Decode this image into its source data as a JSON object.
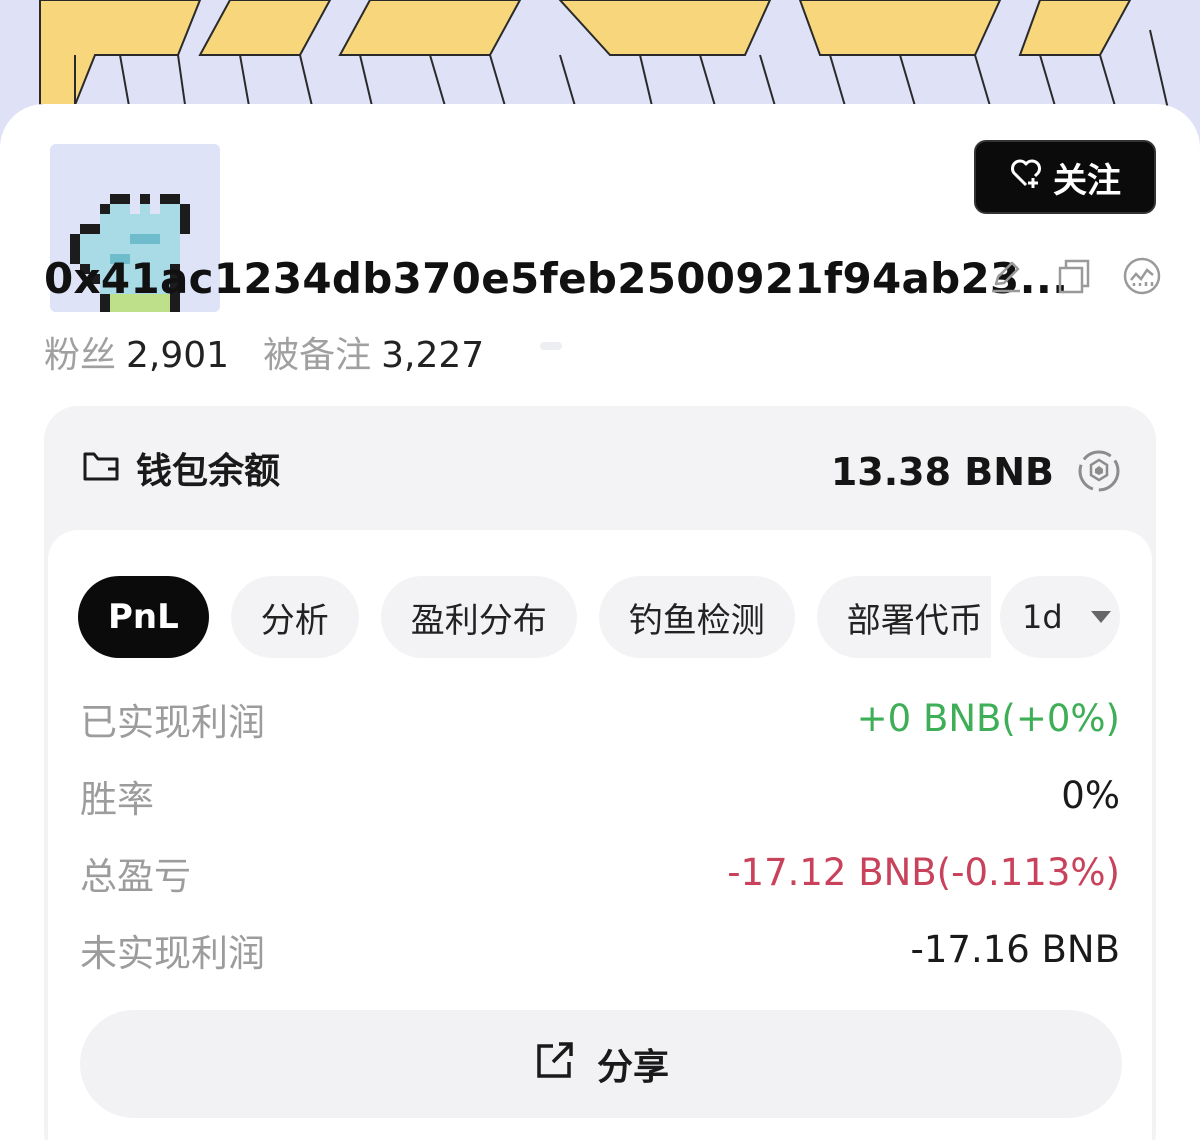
{
  "profile": {
    "follow_label": "关注",
    "address": "0x41ac1234db370e5feb2500921f94ab23...",
    "followers_label": "粉丝",
    "followers_value": "2,901",
    "noted_label": "被备注",
    "noted_value": "3,227"
  },
  "wallet": {
    "title": "钱包余额",
    "balance": "13.38 BNB"
  },
  "tabs": [
    {
      "label": "PnL"
    },
    {
      "label": "分析"
    },
    {
      "label": "盈利分布"
    },
    {
      "label": "钓鱼检测"
    },
    {
      "label": "部署代币"
    }
  ],
  "period": "1d",
  "metrics": [
    {
      "label": "已实现利润",
      "value": "+0 BNB(+0%)"
    },
    {
      "label": "胜率",
      "value": "0%"
    },
    {
      "label": "总盈亏",
      "value": "-17.12 BNB(-0.113%)"
    },
    {
      "label": "未实现利润",
      "value": "-17.16 BNB"
    }
  ],
  "share_label": "分享",
  "colors": {
    "banner_yellow": "#f7d67c",
    "positive": "#3eae57",
    "negative": "#c9425b",
    "button_dark": "#0b0b0b"
  },
  "icons": [
    "heart-plus-icon",
    "edit-icon",
    "copy-icon",
    "chart-icon",
    "wallet-icon",
    "bnb-chain-icon",
    "share-icon",
    "chevron-down-icon"
  ]
}
